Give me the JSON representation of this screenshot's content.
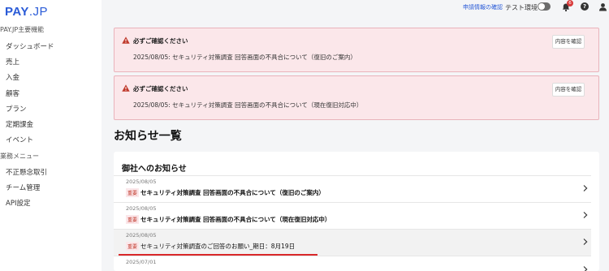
{
  "sidebar": {
    "logo_pay": "PAY",
    "logo_jp": ".JP",
    "section_main": "PAY.JP主要機能",
    "main_items": [
      "ダッシュボード",
      "売上",
      "入金",
      "顧客",
      "プラン",
      "定期課金",
      "イベント"
    ],
    "section_ops": "業務メニュー",
    "ops_items": [
      "不正懸念取引",
      "チーム管理",
      "API設定"
    ]
  },
  "header": {
    "application_link": "申請情報の確認",
    "env_label": "テスト環境",
    "notification_count": "6",
    "help_glyph": "?"
  },
  "alerts": [
    {
      "title": "必ずご確認ください",
      "message": "2025/08/05: セキュリティ対策調査 回答画面の不具合について（復旧のご案内）",
      "button": "内容を確認"
    },
    {
      "title": "必ずご確認ください",
      "message": "2025/08/05: セキュリティ対策調査 回答画面の不具合について（現在復旧対応中）",
      "button": "内容を確認"
    }
  ],
  "main": {
    "page_title": "お知らせ一覧",
    "section_title": "御社へのお知らせ",
    "rows": [
      {
        "date": "2025/08/05",
        "tag": "重要",
        "title": "セキュリティ対策調査 回答画面の不具合について（復旧のご案内）"
      },
      {
        "date": "2025/08/05",
        "tag": "重要",
        "title": "セキュリティ対策調査 回答画面の不具合について（現在復旧対応中）"
      },
      {
        "date": "2025/08/05",
        "tag": "重要",
        "title": "セキュリティ対策調査のご回答のお願い_期日：8月19日"
      },
      {
        "date": "2025/07/01",
        "tag": "",
        "title": ""
      }
    ]
  },
  "colors": {
    "brand": "#2a5bd7",
    "alert_bg": "#fbe7ea",
    "important": "#c0392b",
    "highlight_underline": "#d9282a"
  }
}
